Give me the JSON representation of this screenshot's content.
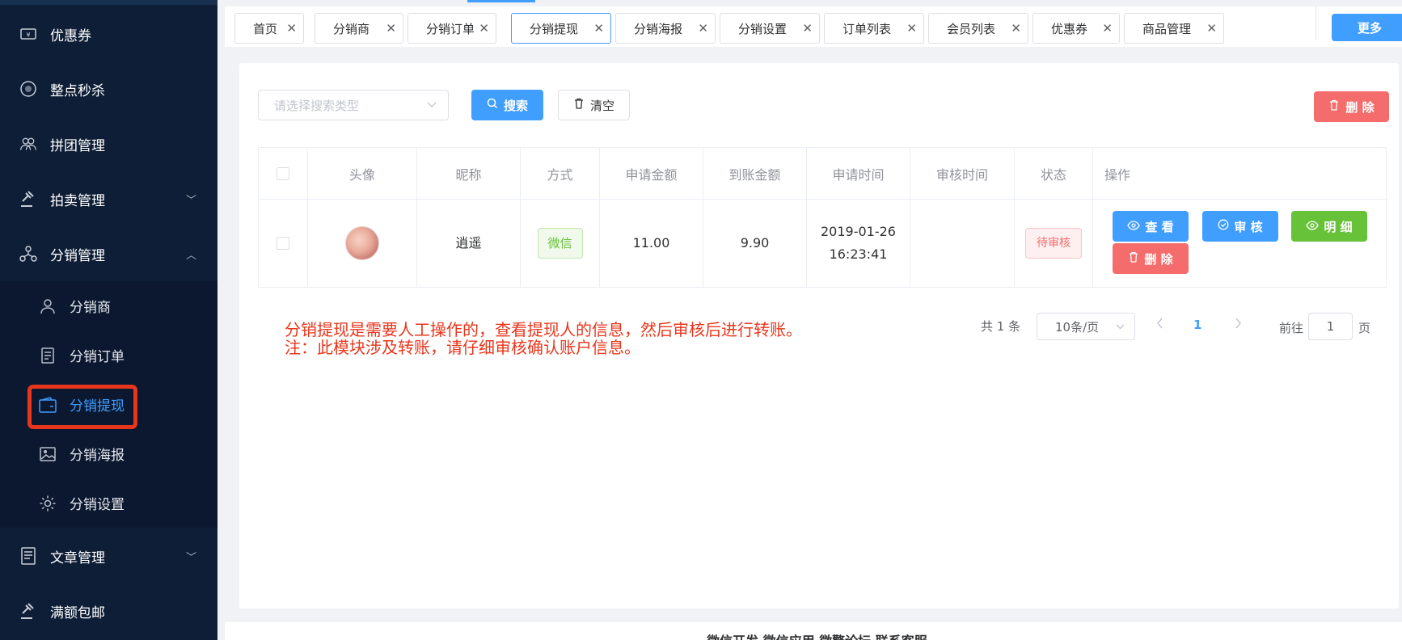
{
  "sidebar": {
    "items_top": [
      {
        "label": "优惠券",
        "icon": "coupon-icon"
      },
      {
        "label": "整点秒杀",
        "icon": "flash-sale-icon"
      },
      {
        "label": "拼团管理",
        "icon": "group-icon"
      },
      {
        "label": "拍卖管理",
        "icon": "gavel-icon",
        "arrow": "﹀"
      },
      {
        "label": "分销管理",
        "icon": "distribution-icon",
        "arrow": "︿"
      }
    ],
    "submenu": [
      {
        "label": "分销商",
        "icon": "user-icon"
      },
      {
        "label": "分销订单",
        "icon": "document-icon"
      },
      {
        "label": "分销提现",
        "icon": "wallet-icon"
      },
      {
        "label": "分销海报",
        "icon": "image-icon"
      },
      {
        "label": "分销设置",
        "icon": "gear-icon"
      }
    ],
    "items_bottom": [
      {
        "label": "文章管理",
        "icon": "article-icon",
        "arrow": "﹀"
      },
      {
        "label": "满额包邮",
        "icon": "gavel-icon"
      }
    ],
    "active_item": "分销提现"
  },
  "tabs": [
    {
      "label": "首页"
    },
    {
      "label": "分销商"
    },
    {
      "label": "分销订单"
    },
    {
      "label": "分销提现",
      "active": true
    },
    {
      "label": "分销海报"
    },
    {
      "label": "分销设置"
    },
    {
      "label": "订单列表"
    },
    {
      "label": "会员列表"
    },
    {
      "label": "优惠券"
    },
    {
      "label": "商品管理"
    }
  ],
  "more_label": "更多",
  "toolbar": {
    "search_placeholder": "请选择搜索类型",
    "search_label": "搜索",
    "clear_label": "清空",
    "delete_label": "删 除"
  },
  "table": {
    "headers": [
      "头像",
      "昵称",
      "方式",
      "申请金额",
      "到账金额",
      "申请时间",
      "审核时间",
      "状态",
      "操作"
    ],
    "rows": [
      {
        "nickname": "逍遥",
        "method": "微信",
        "apply_amount": "11.00",
        "received_amount": "9.90",
        "apply_time_date": "2019-01-26",
        "apply_time_clock": "16:23:41",
        "audit_time": "",
        "status": "待审核",
        "actions": {
          "view": "查 看",
          "audit": "审 核",
          "detail": "明 细",
          "delete": "删 除"
        }
      }
    ]
  },
  "note": {
    "line1": "分销提现是需要人工操作的，查看提现人的信息，然后审核后进行转账。",
    "line2": "注：此模块涉及转账，请仔细审核确认账户信息。"
  },
  "pagination": {
    "total": "共 1 条",
    "page_size": "10条/页",
    "current_page": "1",
    "goto_label": "前往",
    "goto_value": "1",
    "page_unit": "页"
  },
  "footer_text": "微信开发 微信应用 微擎论坛 联系客服",
  "colors": {
    "primary": "#409eff",
    "danger": "#f56c6c",
    "success": "#67c23a",
    "sidebar": "#0e1e36",
    "annotation": "#e8361c"
  }
}
